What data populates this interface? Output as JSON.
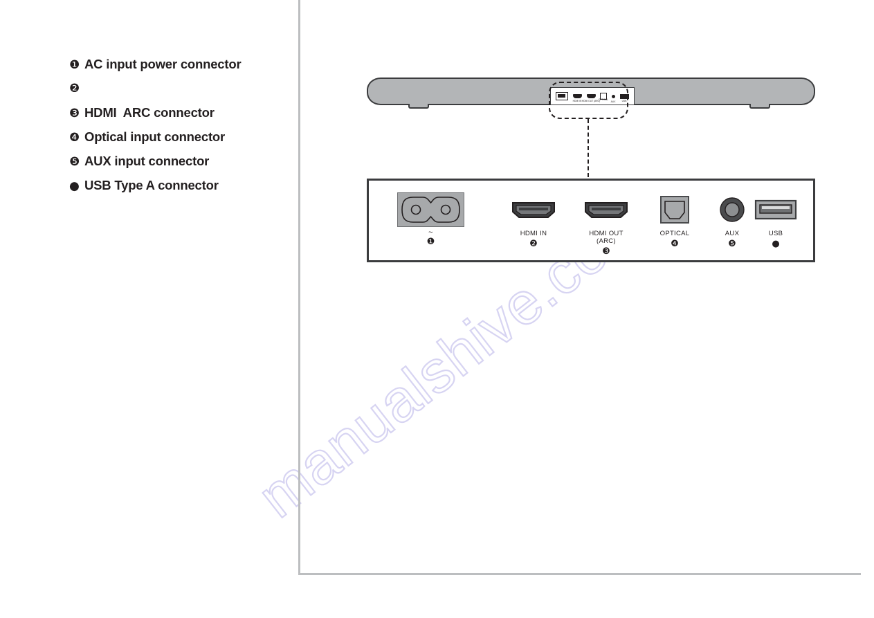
{
  "document": {
    "type": "manual-page",
    "watermark": "manualshive.com",
    "watermark_color": "#d7d4f2",
    "line_color": "#bcbec0",
    "ink_color": "#231f20"
  },
  "legend": {
    "items": [
      {
        "marker": "❶",
        "marker_name": "circled-one",
        "label": "AC input power connector"
      },
      {
        "marker": "❷",
        "marker_name": "circled-two",
        "label": ""
      },
      {
        "marker": "❸",
        "marker_name": "circled-three",
        "label": "HDMI  ARC connector"
      },
      {
        "marker": "❹",
        "marker_name": "circled-four",
        "label": "Optical input connector"
      },
      {
        "marker": "❺",
        "marker_name": "circled-five",
        "label": "AUX input connector"
      },
      {
        "marker": "●",
        "marker_name": "filled-circle",
        "label": "USB Type A connector"
      }
    ]
  },
  "soundbar": {
    "body_color": "#b3b5b7",
    "outline_color": "#3b3c3e",
    "mini_panel": {
      "ports": [
        {
          "name": "ac-inlet",
          "label": ""
        },
        {
          "name": "hdmi-in",
          "label": "HDMI IN"
        },
        {
          "name": "hdmi-out",
          "label": "HDMI OUT\n(ARC)"
        },
        {
          "name": "optical",
          "label": "OPTICAL"
        },
        {
          "name": "aux",
          "label": "AUX"
        },
        {
          "name": "usb",
          "label": "USB"
        }
      ]
    }
  },
  "callout": {
    "style": "dashed",
    "color": "#231f20"
  },
  "connector_panel": {
    "ports": [
      {
        "id": "ac",
        "icon": "ac-inlet-c7-icon",
        "caption": "~",
        "number": "❶",
        "number_name": "circled-one"
      },
      {
        "id": "hdmi-in",
        "icon": "hdmi-port-icon",
        "caption": "HDMI IN",
        "number": "❷",
        "number_name": "circled-two"
      },
      {
        "id": "hdmi-out",
        "icon": "hdmi-port-icon",
        "caption": "HDMI OUT\n(ARC)",
        "number": "❸",
        "number_name": "circled-three"
      },
      {
        "id": "optical",
        "icon": "optical-toslink-icon",
        "caption": "OPTICAL",
        "number": "❹",
        "number_name": "circled-four"
      },
      {
        "id": "aux",
        "icon": "aux-jack-icon",
        "caption": "AUX",
        "number": "❺",
        "number_name": "circled-five"
      },
      {
        "id": "usb",
        "icon": "usb-type-a-icon",
        "caption": "USB",
        "number": "●",
        "number_name": "filled-circle"
      }
    ]
  }
}
